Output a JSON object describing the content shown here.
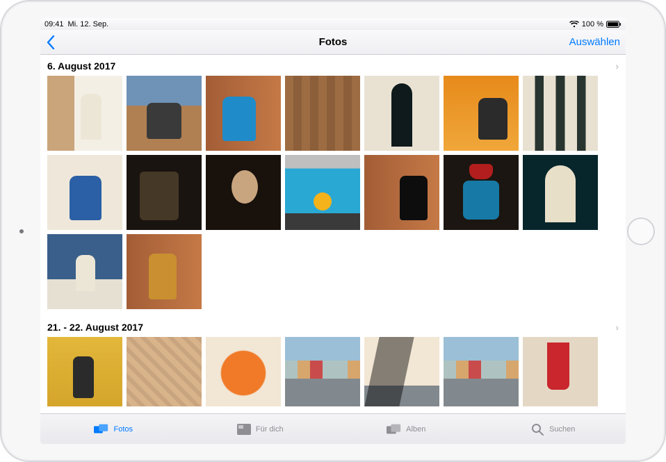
{
  "status": {
    "time": "09:41",
    "date": "Mi. 12. Sep.",
    "battery_pct": "100 %"
  },
  "nav": {
    "title": "Fotos",
    "select_label": "Auswählen"
  },
  "sections": [
    {
      "title": "6. August 2017",
      "photos": [
        {
          "name": "man-white-robe-sitting"
        },
        {
          "name": "woman-market-square"
        },
        {
          "name": "man-blue-shirt-brown-wall"
        },
        {
          "name": "earth-tone-wall"
        },
        {
          "name": "dark-arches-hall"
        },
        {
          "name": "woman-orange-drink"
        },
        {
          "name": "columns-courtyard"
        },
        {
          "name": "woman-thumbs-up"
        },
        {
          "name": "night-alley"
        },
        {
          "name": "woman-dark-portrait"
        },
        {
          "name": "blue-shirt-orange-ball"
        },
        {
          "name": "woman-leaning-wall"
        },
        {
          "name": "man-red-hat-teal"
        },
        {
          "name": "figure-teal-archway"
        },
        {
          "name": "man-sitting-blue-sky"
        },
        {
          "name": "man-drinking-brown-wall"
        }
      ]
    },
    {
      "title": "21. - 22. August 2017",
      "photos": [
        {
          "name": "man-yellow-wall"
        },
        {
          "name": "shadow-pattern-torso"
        },
        {
          "name": "papaya-plate"
        },
        {
          "name": "colorful-street-houses"
        },
        {
          "name": "shadow-street-person"
        },
        {
          "name": "street-houses-2"
        },
        {
          "name": "red-skirt-legs"
        }
      ]
    }
  ],
  "tabs": [
    {
      "id": "photos",
      "label": "Fotos",
      "active": true
    },
    {
      "id": "foryou",
      "label": "Für dich",
      "active": false
    },
    {
      "id": "albums",
      "label": "Alben",
      "active": false
    },
    {
      "id": "search",
      "label": "Suchen",
      "active": false
    }
  ]
}
